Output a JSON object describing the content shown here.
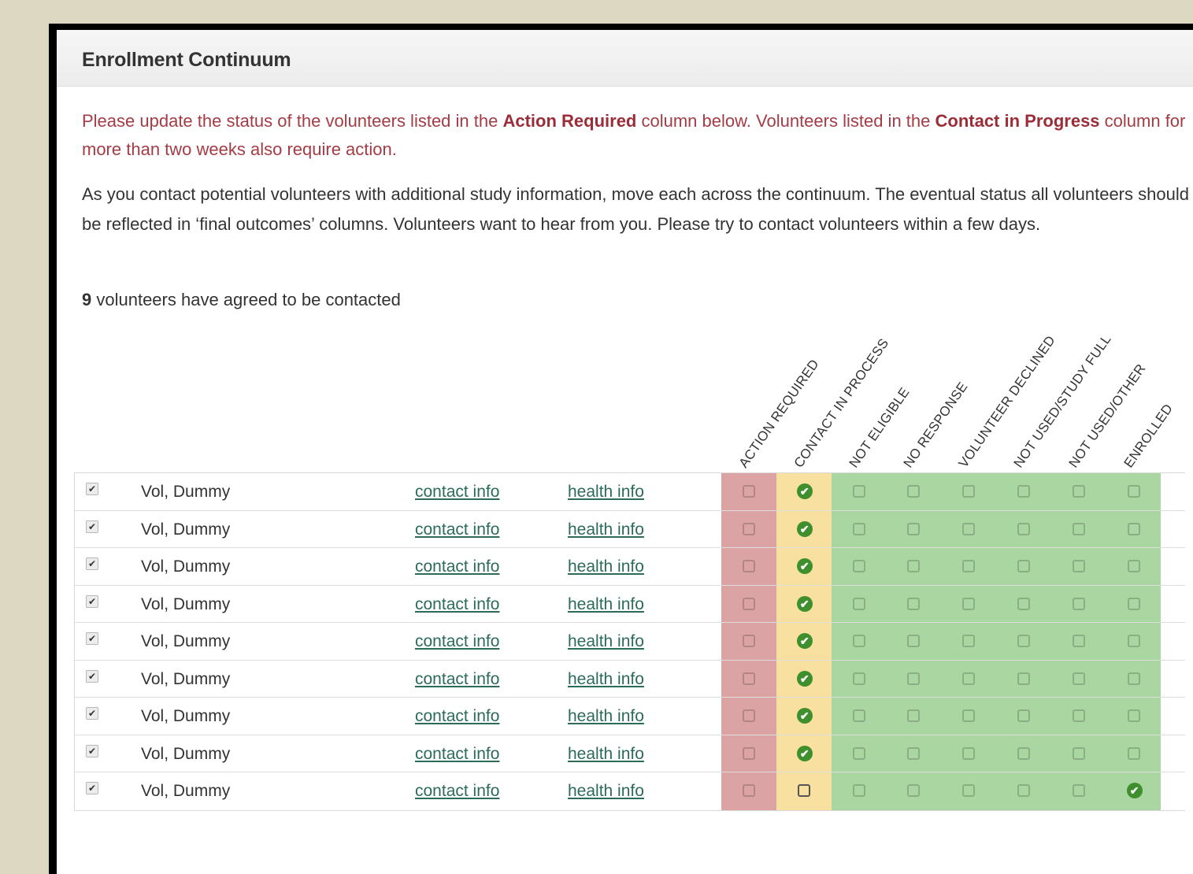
{
  "panel": {
    "title": "Enrollment Continuum"
  },
  "message": {
    "part1": "Please update the status of the volunteers listed in the ",
    "bold1": "Action Required",
    "part2": " column below. Volunteers listed in the ",
    "bold2": "Contact in Progress",
    "part3": " column for more than two weeks also require action."
  },
  "info_text": "As you contact potential volunteers with additional study information, move each across the continuum. The eventual status all volunteers should be reflected in ‘final outcomes’ columns. Volunteers want to hear from you. Please try to contact volunteers within a few days.",
  "volunteer_count": {
    "number": "9",
    "label": " volunteers have agreed to be contacted"
  },
  "columns": [
    "ACTION REQUIRED",
    "CONTACT IN PROCESS",
    "NOT ELIGIBLE",
    "NO RESPONSE",
    "VOLUNTEER DECLINED",
    "NOT USED/STUDY FULL",
    "NOT USED/OTHER",
    "ENROLLED"
  ],
  "colors": {
    "action_required": "#dba3a3",
    "contact_in_process": "#f7e0a0",
    "final_outcomes": "#a9d6a1",
    "link": "#2c6b5a",
    "alert_text": "#a43c45"
  },
  "icons": {
    "selected": "check-circle-icon",
    "unselected": "empty-checkbox-icon",
    "row_checkbox": "checked-checkbox-icon"
  },
  "rows": [
    {
      "name": "Vol, Dummy",
      "contact": "contact info",
      "health": "health info",
      "status": 1
    },
    {
      "name": "Vol, Dummy",
      "contact": "contact info",
      "health": "health info",
      "status": 1
    },
    {
      "name": "Vol, Dummy",
      "contact": "contact info",
      "health": "health info",
      "status": 1
    },
    {
      "name": "Vol, Dummy",
      "contact": "contact info",
      "health": "health info",
      "status": 1
    },
    {
      "name": "Vol, Dummy",
      "contact": "contact info",
      "health": "health info",
      "status": 1
    },
    {
      "name": "Vol, Dummy",
      "contact": "contact info",
      "health": "health info",
      "status": 1
    },
    {
      "name": "Vol, Dummy",
      "contact": "contact info",
      "health": "health info",
      "status": 1
    },
    {
      "name": "Vol, Dummy",
      "contact": "contact info",
      "health": "health info",
      "status": 1
    },
    {
      "name": "Vol, Dummy",
      "contact": "contact info",
      "health": "health info",
      "status": 7
    }
  ]
}
